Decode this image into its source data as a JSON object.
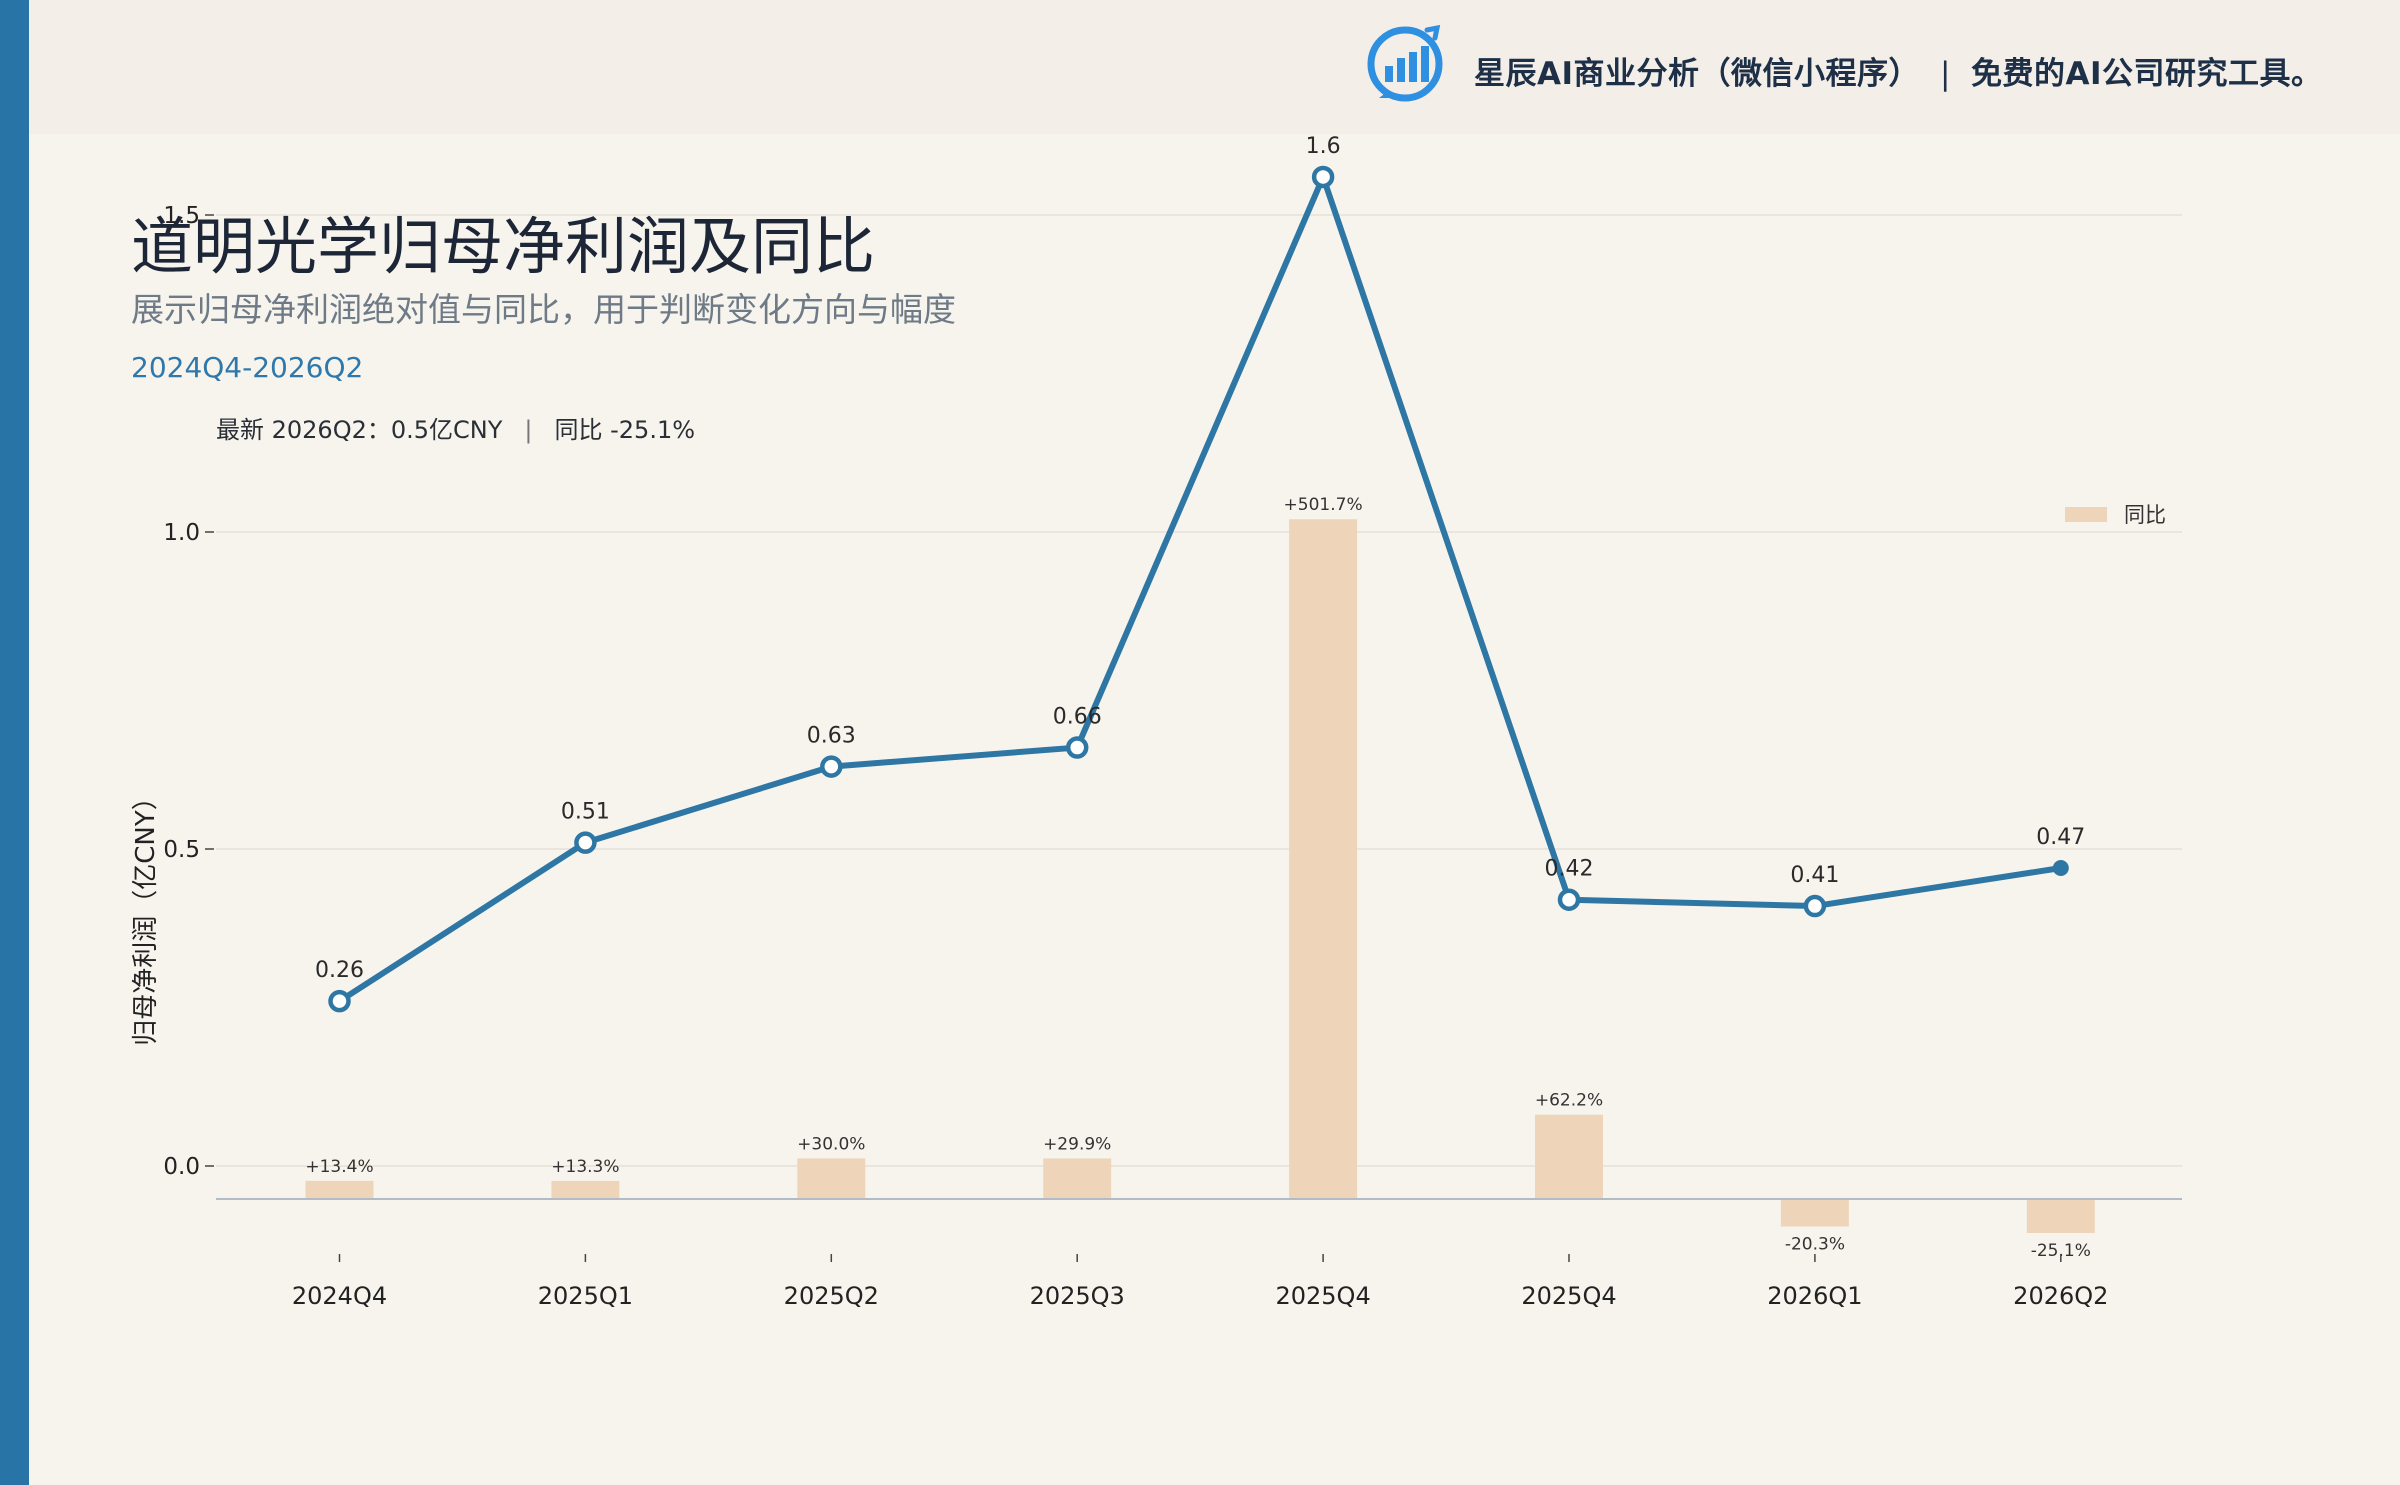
{
  "brand": {
    "name": "星辰AI商业分析（微信小程序）",
    "separator": "|",
    "tagline": "免费的AI公司研究工具。",
    "logo_icon": "bar-chart-growth-icon"
  },
  "header": {
    "title": "道明光学归母净利润及同比",
    "subtitle": "展示归母净利润绝对值与同比，用于判断变化方向与幅度",
    "period": "2024Q4-2026Q2"
  },
  "latest": {
    "label": "最新 2026Q2：0.5亿CNY",
    "separator": "|",
    "yoy": "同比 -25.1%"
  },
  "colors": {
    "accent": "#2874a6",
    "line": "#2e77a5",
    "bar": "#eed5b9",
    "background": "#f7f4ee",
    "header_band": "#f3efe8"
  },
  "chart_data": {
    "type": "line",
    "categories": [
      "2024Q4",
      "2025Q1",
      "2025Q2",
      "2025Q3",
      "2025Q4",
      "2025Q4",
      "2026Q1",
      "2026Q2"
    ],
    "series": [
      {
        "name": "",
        "type": "line",
        "values": [
          0.26,
          0.51,
          0.63,
          0.66,
          1.56,
          0.42,
          0.41,
          0.47
        ],
        "labels": [
          "0.26",
          "0.51",
          "0.63",
          "0.66",
          "1.6",
          "0.42",
          "0.41",
          "0.47"
        ]
      },
      {
        "name": "同比",
        "type": "bar",
        "secondary_axis": true,
        "values": [
          13.4,
          13.3,
          30.0,
          29.9,
          501.7,
          62.2,
          -20.3,
          -25.1
        ],
        "labels": [
          "+13.4%",
          "+13.3%",
          "+30.0%",
          "+29.9%",
          "+501.7%",
          "+62.2%",
          "-20.3%",
          "-25.1%"
        ]
      }
    ],
    "ylabel": "归母净利润（亿CNY）",
    "ylim": [
      -0.1,
      2.1
    ],
    "yticks": [
      "0.0",
      "0.5",
      "1.0",
      "1.5",
      "2.0"
    ],
    "y2lim": [
      -40,
      520
    ],
    "grid": true,
    "legend": "top-right"
  }
}
